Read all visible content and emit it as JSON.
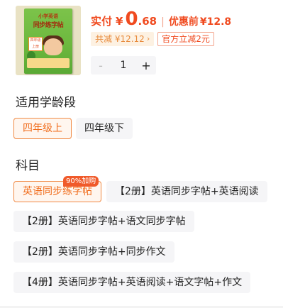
{
  "product": {
    "cover": {
      "series": "小学英语",
      "title": "同步练字帖",
      "grade_tag": "四年级上册"
    },
    "price": {
      "actual_label": "实付",
      "currency": "¥",
      "integer": "0",
      "decimal": ".68",
      "separator": "|",
      "original_label": "优惠前",
      "original_value": "¥12.8"
    },
    "savings": {
      "label": "共减 ¥12.12",
      "chevron": "›"
    },
    "official_discount": "官方立减2元",
    "quantity": {
      "minus": "-",
      "value": "1",
      "plus": "+"
    },
    "accent_color": "#f04a1f"
  },
  "grade_section": {
    "title": "适用学龄段",
    "options": [
      {
        "label": "四年级上",
        "selected": true
      },
      {
        "label": "四年级下",
        "selected": false
      }
    ]
  },
  "subject_section": {
    "title": "科目",
    "badge": "90%加购",
    "options": [
      {
        "label": "英语同步练字帖",
        "selected": true
      },
      {
        "label": "【2册】英语同步字帖+英语阅读",
        "selected": false
      },
      {
        "label": "【2册】英语同步字帖+语文同步字帖",
        "selected": false
      },
      {
        "label": "【2册】英语同步字帖+同步作文",
        "selected": false
      },
      {
        "label": "【4册】英语同步字帖+英语阅读+语文字帖+作文",
        "selected": false
      }
    ]
  }
}
